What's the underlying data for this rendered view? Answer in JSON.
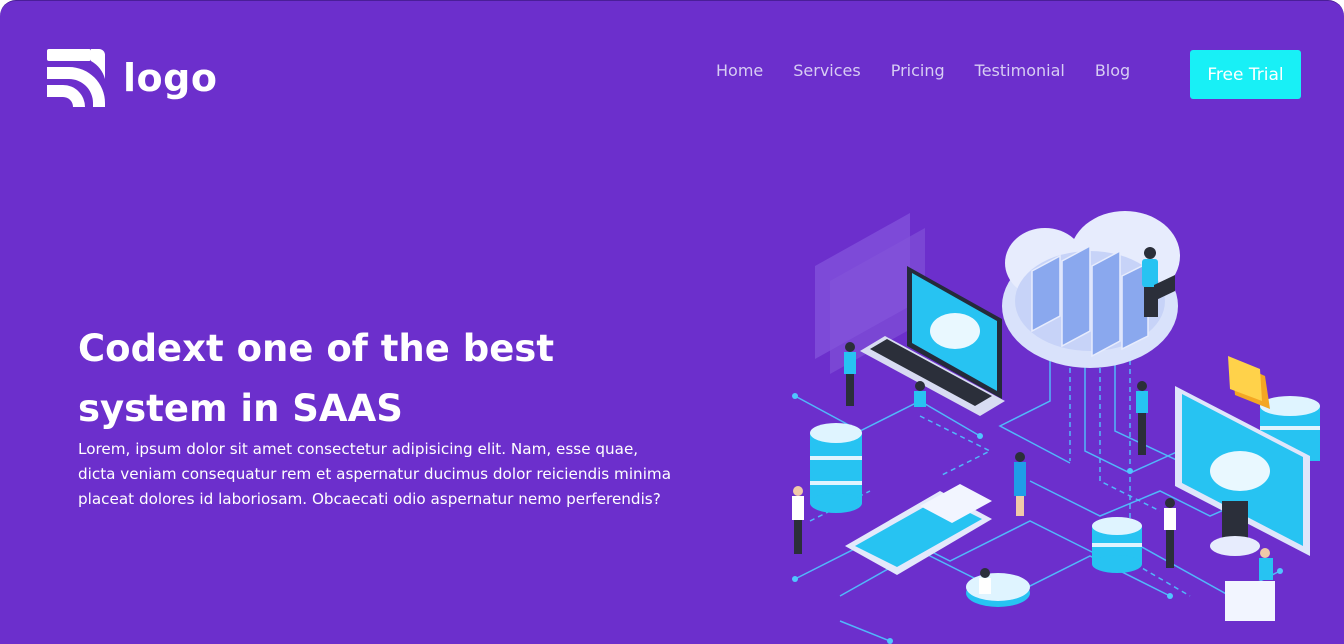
{
  "header": {
    "brand": {
      "text": "logo",
      "icon": "signal-waves-logo-icon"
    },
    "nav": [
      {
        "label": "Home"
      },
      {
        "label": "Services"
      },
      {
        "label": "Pricing"
      },
      {
        "label": "Testimonial"
      },
      {
        "label": "Blog"
      }
    ],
    "cta_label": "Free Trial"
  },
  "hero": {
    "headline": "Codext one of the best system in SAAS",
    "body": "Lorem, ipsum dolor sit amet consectetur adipisicing elit. Nam, esse quae, dicta veniam consequatur rem et aspernatur ducimus dolor reiciendis minima placeat dolores id laboriosam. Obcaecati odio aspernatur nemo perferendis?"
  },
  "colors": {
    "background": "#6c2fcc",
    "accent": "#18f0f6",
    "nav_text": "#d7cdf3",
    "text": "#ffffff"
  },
  "illustration": {
    "icons": [
      "cloud-server-icon",
      "laptop-icon",
      "database-icon",
      "monitor-icon",
      "folder-icon",
      "smartphone-icon",
      "people-icon"
    ]
  }
}
